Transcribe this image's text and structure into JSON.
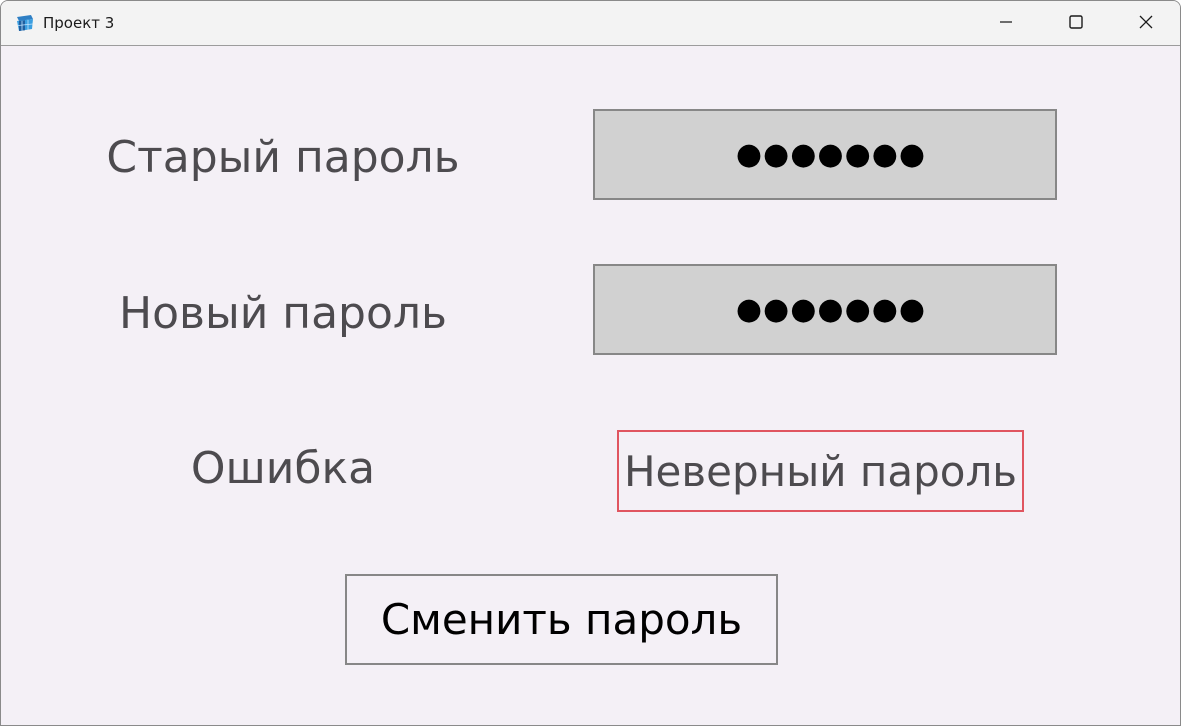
{
  "window": {
    "title": "Проект 3",
    "icon": "app-icon",
    "controls": {
      "minimize": "minimize-icon",
      "maximize": "maximize-icon",
      "close": "close-icon"
    }
  },
  "form": {
    "old_password": {
      "label": "Старый пароль",
      "value_masked": "●●●●●●●"
    },
    "new_password": {
      "label": "Новый пароль",
      "value_masked": "●●●●●●●"
    },
    "error": {
      "label": "Ошибка",
      "message": "Неверный пароль"
    },
    "submit_label": "Сменить пароль"
  },
  "colors": {
    "background": "#f4f0f6",
    "field_fill": "#d1d1d1",
    "field_border": "#878787",
    "label_text": "#4d4b4f",
    "error_border": "#e05560"
  }
}
